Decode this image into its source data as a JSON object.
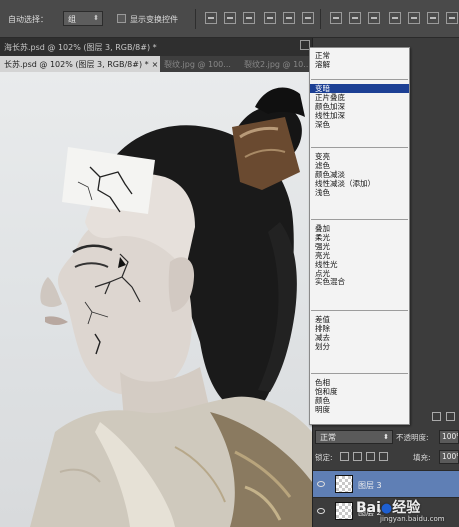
{
  "options_bar": {
    "auto_select_label": "自动选择：",
    "auto_select_value": "组",
    "show_transform_label": "显示变换控件"
  },
  "tabs": [
    {
      "label": "海长苏.psd @ 102% (图层 3, RGB/8#) *"
    },
    {
      "label": "长苏.psd @ 102% (图层 3, RGB/8#) *"
    },
    {
      "label": "裂纹.jpg @ 100..."
    },
    {
      "label": "裂纹2.jpg @ 10..."
    }
  ],
  "blend_menu": {
    "groups": [
      [
        "正常",
        "溶解"
      ],
      [
        "变暗",
        "正片叠底",
        "颜色加深",
        "线性加深",
        "深色"
      ],
      [
        "变亮",
        "滤色",
        "颜色减淡",
        "线性减淡（添加）",
        "浅色"
      ],
      [
        "叠加",
        "柔光",
        "强光",
        "亮光",
        "线性光",
        "点光",
        "实色混合"
      ],
      [
        "差值",
        "排除",
        "减去",
        "划分"
      ],
      [
        "色相",
        "饱和度",
        "颜色",
        "明度"
      ]
    ],
    "selected": "变暗"
  },
  "layers_panel": {
    "blend_mode": "正常",
    "opacity_label": "不透明度:",
    "opacity_value": "100%",
    "lock_label": "锁定:",
    "fill_label": "填充:",
    "fill_value": "100%",
    "layers": [
      {
        "name": "图层 3",
        "active": true
      },
      {
        "name": "图层 2",
        "active": false
      }
    ]
  },
  "watermark": {
    "text": "Bai",
    "text2": "经验",
    "url": "jingyan.baidu.com"
  },
  "colors": {
    "selection": "#1c3f94",
    "active_layer": "#5f7fb5",
    "panel_bg": "#3c3c3c"
  }
}
